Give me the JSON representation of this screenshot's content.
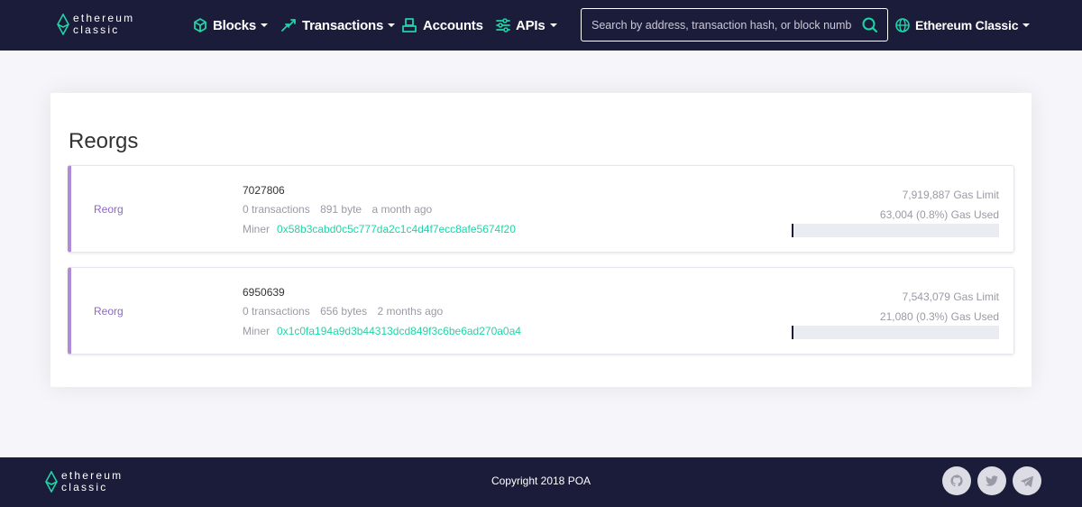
{
  "brand": {
    "line1": "ethereum",
    "line2": "classic"
  },
  "nav": {
    "blocks": "Blocks",
    "transactions": "Transactions",
    "accounts": "Accounts",
    "apis": "APIs",
    "network": "Ethereum Classic"
  },
  "search": {
    "placeholder": "Search by address, transaction hash, or block number"
  },
  "page": {
    "title": "Reorgs"
  },
  "reorgs": [
    {
      "type": "Reorg",
      "number": "7027806",
      "transactions": "0 transactions",
      "size": "891 byte",
      "age": "a month ago",
      "miner_label": "Miner",
      "miner": "0x58b3cabd0c5c777da2c1c4d4f7ecc8afe5674f20",
      "gas_limit": "7,919,887 Gas Limit",
      "gas_used": "63,004 (0.8%) Gas Used",
      "gas_used_pct": 0.8
    },
    {
      "type": "Reorg",
      "number": "6950639",
      "transactions": "0 transactions",
      "size": "656 bytes",
      "age": "2 months ago",
      "miner_label": "Miner",
      "miner": "0x1c0fa194a9d3b44313dcd849f3c6be6ad270a0a4",
      "gas_limit": "7,543,079 Gas Limit",
      "gas_used": "21,080 (0.3%) Gas Used",
      "gas_used_pct": 0.3
    }
  ],
  "footer": {
    "copyright": "Copyright 2018 POA"
  },
  "colors": {
    "header_bg": "#1b1b3a",
    "accent_green": "#20d4a7",
    "reorg_purple": "#b08bd8",
    "gas_bar_bg": "#e9ecf0"
  },
  "icons": {
    "logo": "ethereum-classic-logo",
    "blocks": "cube-icon",
    "transactions": "arrows-icon",
    "accounts": "account-icon",
    "apis": "sliders-icon",
    "search": "search-icon",
    "network": "globe-icon",
    "social": [
      "github-icon",
      "twitter-icon",
      "telegram-icon"
    ]
  }
}
